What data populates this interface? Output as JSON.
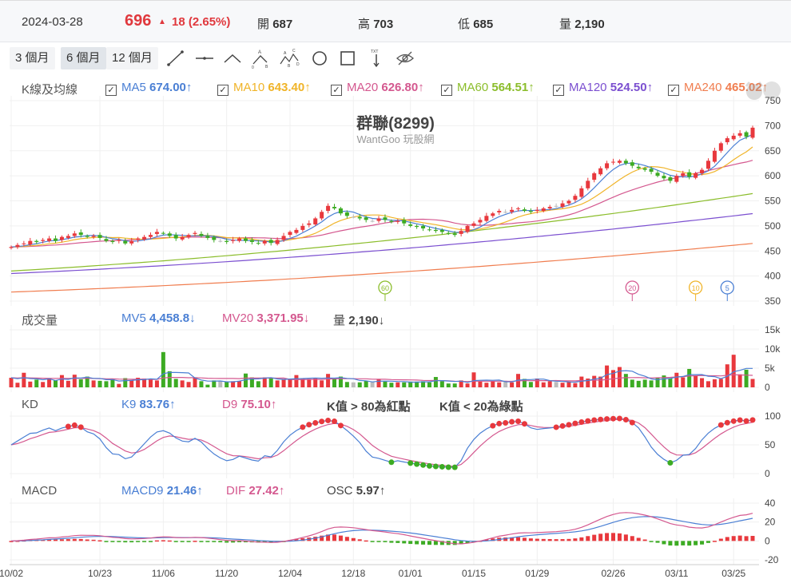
{
  "header": {
    "date": "2024-03-28",
    "price": "696",
    "change": "18 (2.65%)",
    "open_label": "開",
    "open": "687",
    "high_label": "高",
    "high": "703",
    "low_label": "低",
    "low": "685",
    "vol_label": "量",
    "volume": "2,190"
  },
  "toolbar": {
    "ranges": [
      "3 個月",
      "6 個月",
      "12 個月"
    ],
    "active_range": 1,
    "tools": [
      "trend-line-icon",
      "horizontal-line-icon",
      "angle-line-icon",
      "abc-pattern-icon",
      "abcd-pattern-icon",
      "circle-icon",
      "rectangle-icon",
      "text-tool-icon",
      "hide-eye-icon"
    ],
    "txt_glyph": "TXT"
  },
  "price_panel": {
    "label": "K線及均線",
    "title": "群聯(8299)",
    "watermark": "WantGoo 玩股網",
    "mas": [
      {
        "name": "MA5",
        "value": "674.00",
        "arrow": "↑",
        "color": "#4a7fd4"
      },
      {
        "name": "MA10",
        "value": "643.40",
        "arrow": "↑",
        "color": "#f0b429"
      },
      {
        "name": "MA20",
        "value": "626.80",
        "arrow": "↑",
        "color": "#d4588f"
      },
      {
        "name": "MA60",
        "value": "564.51",
        "arrow": "↑",
        "color": "#8bbd2b"
      },
      {
        "name": "MA120",
        "value": "524.50",
        "arrow": "↑",
        "color": "#7b4fd0"
      },
      {
        "name": "MA240",
        "value": "465.02",
        "arrow": "↑",
        "color": "#f07d4f"
      }
    ],
    "yticks": [
      "750",
      "700",
      "650",
      "600",
      "550",
      "500",
      "450",
      "400",
      "350"
    ],
    "markers": [
      {
        "label": "60",
        "color": "#8bbd2b",
        "index": 59
      },
      {
        "label": "20",
        "color": "#d4588f",
        "index": 98
      },
      {
        "label": "10",
        "color": "#f0b429",
        "index": 108
      },
      {
        "label": "5",
        "color": "#4a7fd4",
        "index": 113
      }
    ]
  },
  "volume_panel": {
    "label": "成交量",
    "mv5_name": "MV5",
    "mv5": "4,458.8",
    "mv5_arrow": "↓",
    "mv20_name": "MV20",
    "mv20": "3,371.95",
    "mv20_arrow": "↓",
    "vol_name": "量",
    "vol": "2,190",
    "vol_arrow": "↓",
    "yticks": [
      "15k",
      "10k",
      "5k",
      "0"
    ]
  },
  "kd_panel": {
    "label": "KD",
    "k_name": "K9",
    "k": "83.76",
    "k_arrow": "↑",
    "d_name": "D9",
    "d": "75.10",
    "d_arrow": "↑",
    "note_red": "K值 > 80為紅點",
    "note_green": "K值 < 20為綠點",
    "yticks": [
      "100",
      "50",
      "0"
    ]
  },
  "macd_panel": {
    "label": "MACD",
    "macd_name": "MACD9",
    "macd": "21.46",
    "macd_arrow": "↑",
    "dif_name": "DIF",
    "dif": "27.42",
    "dif_arrow": "↑",
    "osc_name": "OSC",
    "osc": "5.97",
    "osc_arrow": "↑",
    "yticks": [
      "40",
      "20",
      "0",
      "-20"
    ]
  },
  "colors": {
    "up": "#e8383d",
    "down": "#3cab23",
    "flat": "#bbbbbb",
    "k": "#4a7fd4",
    "d": "#d4588f"
  },
  "chart_data": {
    "type": "candlestick",
    "title": "群聯(8299)",
    "x_dates": [
      {
        "label": "10/02",
        "index": 0
      },
      {
        "label": "10/23",
        "index": 14
      },
      {
        "label": "11/06",
        "index": 24
      },
      {
        "label": "11/20",
        "index": 34
      },
      {
        "label": "12/04",
        "index": 44
      },
      {
        "label": "12/18",
        "index": 54
      },
      {
        "label": "01/01",
        "index": 63
      },
      {
        "label": "01/15",
        "index": 73
      },
      {
        "label": "01/29",
        "index": 83
      },
      {
        "label": "02/26",
        "index": 95
      },
      {
        "label": "03/11",
        "index": 105
      },
      {
        "label": "03/25",
        "index": 114
      }
    ],
    "price_ylim": [
      350,
      750
    ],
    "close": [
      458,
      462,
      465,
      470,
      468,
      472,
      475,
      470,
      478,
      480,
      485,
      482,
      478,
      480,
      476,
      470,
      468,
      472,
      465,
      470,
      475,
      478,
      482,
      488,
      485,
      480,
      475,
      478,
      482,
      486,
      480,
      476,
      472,
      470,
      468,
      472,
      475,
      470,
      468,
      465,
      470,
      466,
      472,
      480,
      488,
      492,
      500,
      505,
      515,
      528,
      540,
      535,
      525,
      520,
      518,
      515,
      512,
      510,
      515,
      512,
      508,
      510,
      505,
      500,
      498,
      495,
      492,
      490,
      488,
      485,
      482,
      490,
      500,
      505,
      512,
      520,
      525,
      530,
      528,
      532,
      535,
      530,
      528,
      532,
      535,
      538,
      540,
      545,
      550,
      560,
      575,
      590,
      605,
      615,
      625,
      628,
      630,
      625,
      620,
      615,
      612,
      608,
      600,
      595,
      590,
      600,
      605,
      598,
      605,
      612,
      630,
      650,
      665,
      675,
      680,
      685,
      678,
      696
    ],
    "long_ma": {
      "MA60": [
        410,
        564.51
      ],
      "MA120": [
        405,
        524.5
      ],
      "MA240": [
        368,
        465.02
      ]
    },
    "volume_k": [
      2.5,
      1.2,
      3.8,
      1.5,
      2,
      1.4,
      2.3,
      1.8,
      3.2,
      1.7,
      3.3,
      2.1,
      2.8,
      1.8,
      1.7,
      1.6,
      2.2,
      0.9,
      2.4,
      1.9,
      2.5,
      2.3,
      2,
      1.8,
      9.2,
      4.2,
      2.2,
      1.8,
      1.4,
      2.6,
      1.6,
      0.7,
      1.8,
      1.6,
      1.5,
      1.6,
      1.6,
      3.6,
      2.6,
      1.6,
      2.6,
      2.3,
      1.8,
      2,
      2.1,
      3.2,
      2.4,
      2.2,
      2.3,
      1.8,
      3.5,
      2.2,
      2.8,
      1.4,
      1.3,
      1.3,
      1.7,
      1.4,
      2.2,
      1.5,
      1.2,
      1.3,
      1.3,
      1.5,
      1.5,
      1.6,
      1.3,
      2.7,
      1.6,
      1,
      1,
      1.8,
      1,
      3.9,
      1.5,
      1.2,
      1.6,
      1.3,
      1.7,
      1.3,
      3.5,
      2.2,
      1.4,
      2.3,
      1.3,
      1.6,
      1.4,
      1.2,
      1.5,
      1.1,
      2.8,
      2.3,
      3,
      2.8,
      5.7,
      4.5,
      5.3,
      3.5,
      2,
      1.7,
      2,
      1.8,
      2.4,
      3.1,
      2.3,
      3.8,
      2.6,
      4.8,
      3.1,
      2.4,
      1.6,
      2.1,
      2.2,
      6,
      8.5,
      3.4,
      4.6,
      2.19
    ],
    "volume_ylim": [
      0,
      15
    ],
    "kd_ylim": [
      0,
      100
    ],
    "macd_ylim": [
      -20,
      40
    ]
  }
}
